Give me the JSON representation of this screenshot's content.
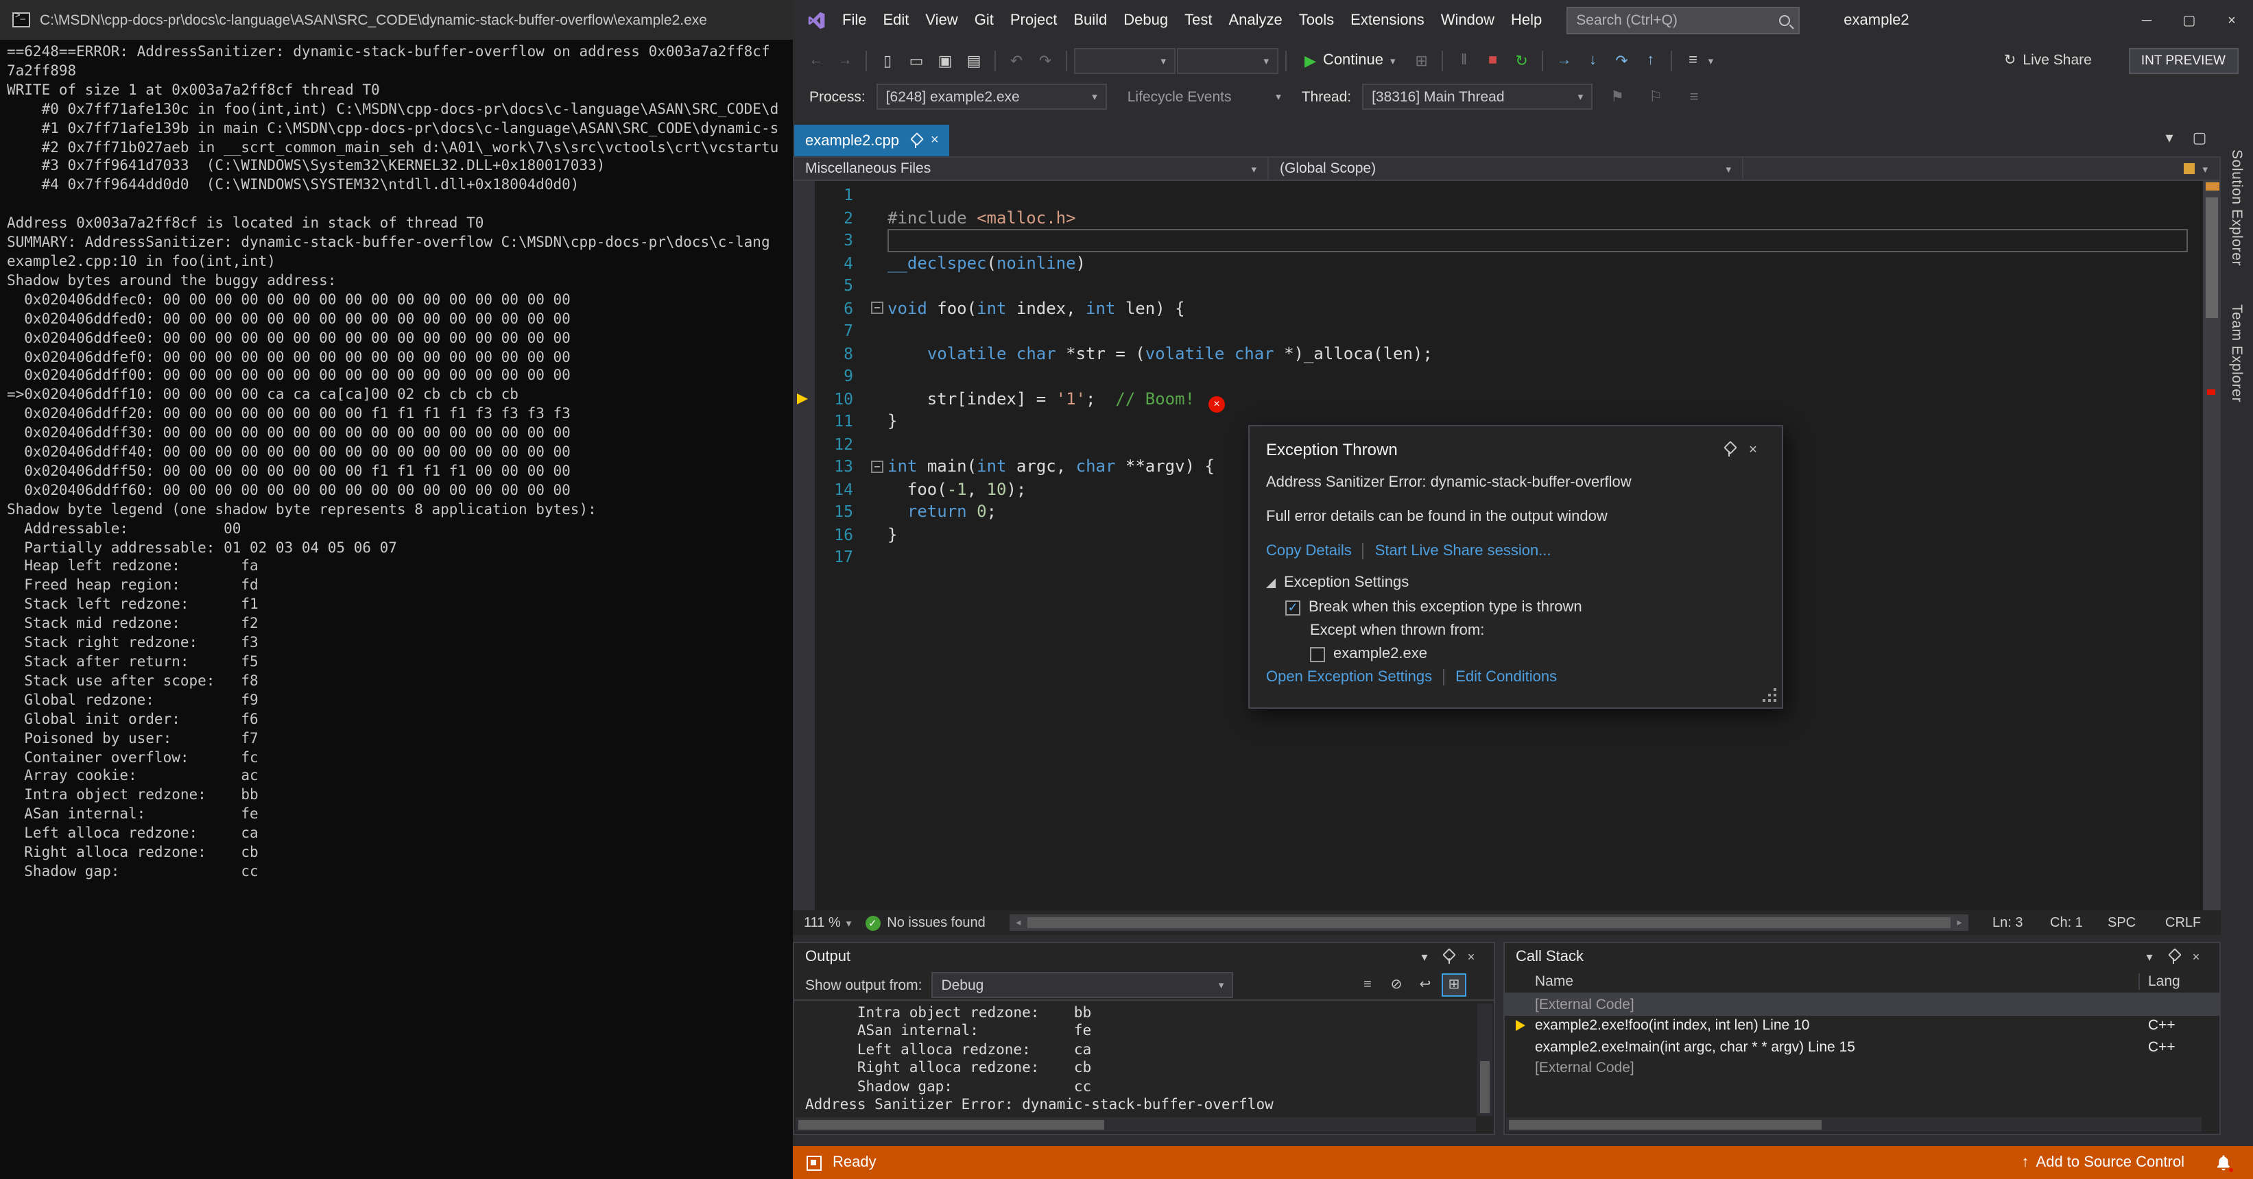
{
  "console": {
    "title": "C:\\MSDN\\cpp-docs-pr\\docs\\c-language\\ASAN\\SRC_CODE\\dynamic-stack-buffer-overflow\\example2.exe",
    "lines": [
      "==6248==ERROR: AddressSanitizer: dynamic-stack-buffer-overflow on address 0x003a7a2ff8cf",
      "7a2ff898",
      "WRITE of size 1 at 0x003a7a2ff8cf thread T0",
      "    #0 0x7ff71afe130c in foo(int,int) C:\\MSDN\\cpp-docs-pr\\docs\\c-language\\ASAN\\SRC_CODE\\d",
      "    #1 0x7ff71afe139b in main C:\\MSDN\\cpp-docs-pr\\docs\\c-language\\ASAN\\SRC_CODE\\dynamic-s",
      "    #2 0x7ff71b027aeb in __scrt_common_main_seh d:\\A01\\_work\\7\\s\\src\\vctools\\crt\\vcstartu",
      "    #3 0x7ff9641d7033  (C:\\WINDOWS\\System32\\KERNEL32.DLL+0x180017033)",
      "    #4 0x7ff9644dd0d0  (C:\\WINDOWS\\SYSTEM32\\ntdll.dll+0x18004d0d0)",
      "",
      "Address 0x003a7a2ff8cf is located in stack of thread T0",
      "SUMMARY: AddressSanitizer: dynamic-stack-buffer-overflow C:\\MSDN\\cpp-docs-pr\\docs\\c-lang",
      "example2.cpp:10 in foo(int,int)",
      "Shadow bytes around the buggy address:",
      "  0x020406ddfec0: 00 00 00 00 00 00 00 00 00 00 00 00 00 00 00 00",
      "  0x020406ddfed0: 00 00 00 00 00 00 00 00 00 00 00 00 00 00 00 00",
      "  0x020406ddfee0: 00 00 00 00 00 00 00 00 00 00 00 00 00 00 00 00",
      "  0x020406ddfef0: 00 00 00 00 00 00 00 00 00 00 00 00 00 00 00 00",
      "  0x020406ddff00: 00 00 00 00 00 00 00 00 00 00 00 00 00 00 00 00",
      "=>0x020406ddff10: 00 00 00 00 ca ca ca[ca]00 02 cb cb cb cb",
      "  0x020406ddff20: 00 00 00 00 00 00 00 00 f1 f1 f1 f1 f3 f3 f3 f3",
      "  0x020406ddff30: 00 00 00 00 00 00 00 00 00 00 00 00 00 00 00 00",
      "  0x020406ddff40: 00 00 00 00 00 00 00 00 00 00 00 00 00 00 00 00",
      "  0x020406ddff50: 00 00 00 00 00 00 00 00 f1 f1 f1 f1 00 00 00 00",
      "  0x020406ddff60: 00 00 00 00 00 00 00 00 00 00 00 00 00 00 00 00",
      "Shadow byte legend (one shadow byte represents 8 application bytes):",
      "  Addressable:           00",
      "  Partially addressable: 01 02 03 04 05 06 07",
      "  Heap left redzone:       fa",
      "  Freed heap region:       fd",
      "  Stack left redzone:      f1",
      "  Stack mid redzone:       f2",
      "  Stack right redzone:     f3",
      "  Stack after return:      f5",
      "  Stack use after scope:   f8",
      "  Global redzone:          f9",
      "  Global init order:       f6",
      "  Poisoned by user:        f7",
      "  Container overflow:      fc",
      "  Array cookie:            ac",
      "  Intra object redzone:    bb",
      "  ASan internal:           fe",
      "  Left alloca redzone:     ca",
      "  Right alloca redzone:    cb",
      "  Shadow gap:              cc"
    ]
  },
  "titlebar": {
    "menus": [
      "File",
      "Edit",
      "View",
      "Git",
      "Project",
      "Build",
      "Debug",
      "Test",
      "Analyze",
      "Tools",
      "Extensions",
      "Window",
      "Help"
    ],
    "search_placeholder": "Search (Ctrl+Q)",
    "window_title": "example2"
  },
  "toolbar": {
    "continue_label": "Continue",
    "live_share_label": "Live Share",
    "preview_badge": "INT PREVIEW"
  },
  "debugbar": {
    "process_label": "Process:",
    "process_value": "[6248] example2.exe",
    "lifecycle_label": "Lifecycle Events",
    "thread_label": "Thread:",
    "thread_value": "[38316] Main Thread"
  },
  "editor": {
    "tab_label": "example2.cpp",
    "nav_project": "Miscellaneous Files",
    "nav_scope": "(Global Scope)",
    "zoom_level": "111 %",
    "issues_text": "No issues found",
    "status": {
      "line": "Ln: 3",
      "column": "Ch: 1",
      "spaces": "SPC",
      "line_ending": "CRLF"
    },
    "lines": [
      {
        "n": 1,
        "tokens": []
      },
      {
        "n": 2,
        "tokens": [
          {
            "t": "#include ",
            "y": "p"
          },
          {
            "t": "<malloc.h>",
            "y": "s"
          }
        ]
      },
      {
        "n": 3,
        "current": true,
        "tokens": []
      },
      {
        "n": 4,
        "tokens": [
          {
            "t": "__declspec",
            "y": "k"
          },
          {
            "t": "(",
            "y": "d"
          },
          {
            "t": "noinline",
            "y": "k"
          },
          {
            "t": ")",
            "y": "d"
          }
        ]
      },
      {
        "n": 5,
        "tokens": []
      },
      {
        "n": 6,
        "fold": true,
        "tokens": [
          {
            "t": "void",
            "y": "k"
          },
          {
            "t": " foo(",
            "y": "d"
          },
          {
            "t": "int",
            "y": "k"
          },
          {
            "t": " index, ",
            "y": "d"
          },
          {
            "t": "int",
            "y": "k"
          },
          {
            "t": " len) {",
            "y": "d"
          }
        ]
      },
      {
        "n": 7,
        "tokens": []
      },
      {
        "n": 8,
        "tokens": [
          {
            "t": "    ",
            "y": "d"
          },
          {
            "t": "volatile",
            "y": "k"
          },
          {
            "t": " ",
            "y": "d"
          },
          {
            "t": "char",
            "y": "k"
          },
          {
            "t": " *str = (",
            "y": "d"
          },
          {
            "t": "volatile",
            "y": "k"
          },
          {
            "t": " ",
            "y": "d"
          },
          {
            "t": "char",
            "y": "k"
          },
          {
            "t": " *)_alloca(len);",
            "y": "d"
          }
        ]
      },
      {
        "n": 9,
        "tokens": []
      },
      {
        "n": 10,
        "arrow": true,
        "error": true,
        "tokens": [
          {
            "t": "    str[index] = ",
            "y": "d"
          },
          {
            "t": "'1'",
            "y": "s"
          },
          {
            "t": ";  ",
            "y": "d"
          },
          {
            "t": "// Boom!",
            "y": "c"
          }
        ]
      },
      {
        "n": 11,
        "tokens": [
          {
            "t": "}",
            "y": "d"
          }
        ]
      },
      {
        "n": 12,
        "tokens": []
      },
      {
        "n": 13,
        "fold": true,
        "tokens": [
          {
            "t": "int",
            "y": "k"
          },
          {
            "t": " main(",
            "y": "d"
          },
          {
            "t": "int",
            "y": "k"
          },
          {
            "t": " argc, ",
            "y": "d"
          },
          {
            "t": "char",
            "y": "k"
          },
          {
            "t": " **argv) {",
            "y": "d"
          }
        ]
      },
      {
        "n": 14,
        "tokens": [
          {
            "t": "  foo(",
            "y": "d"
          },
          {
            "t": "-1",
            "y": "n"
          },
          {
            "t": ", ",
            "y": "d"
          },
          {
            "t": "10",
            "y": "n"
          },
          {
            "t": ");",
            "y": "d"
          }
        ]
      },
      {
        "n": 15,
        "tokens": [
          {
            "t": "  ",
            "y": "d"
          },
          {
            "t": "return",
            "y": "k"
          },
          {
            "t": " ",
            "y": "d"
          },
          {
            "t": "0",
            "y": "n"
          },
          {
            "t": ";",
            "y": "d"
          }
        ]
      },
      {
        "n": 16,
        "tokens": [
          {
            "t": "}",
            "y": "d"
          }
        ]
      },
      {
        "n": 17,
        "tokens": []
      }
    ]
  },
  "exception": {
    "title": "Exception Thrown",
    "message": "Address Sanitizer Error: dynamic-stack-buffer-overflow",
    "detail": "Full error details can be found in the output window",
    "copy_details_label": "Copy Details",
    "live_share_link_label": "Start Live Share session...",
    "settings_header": "Exception Settings",
    "break_label": "Break when this exception type is thrown",
    "break_checked": true,
    "except_label": "Except when thrown from:",
    "module_label": "example2.exe",
    "module_checked": false,
    "open_settings_label": "Open Exception Settings",
    "edit_conditions_label": "Edit Conditions"
  },
  "output": {
    "title": "Output",
    "show_from_label": "Show output from:",
    "selected_source": "Debug",
    "lines": [
      "      Intra object redzone:    bb",
      "      ASan internal:           fe",
      "      Left alloca redzone:     ca",
      "      Right alloca redzone:    cb",
      "      Shadow gap:              cc",
      "Address Sanitizer Error: dynamic-stack-buffer-overflow"
    ]
  },
  "callstack": {
    "title": "Call Stack",
    "columns": [
      "Name",
      "Lang"
    ],
    "rows": [
      {
        "name": "[External Code]",
        "lang": "",
        "external": true,
        "selected": true
      },
      {
        "name": "example2.exe!foo(int index, int len) Line 10",
        "lang": "C++",
        "current": true
      },
      {
        "name": "example2.exe!main(int argc, char * * argv) Line 15",
        "lang": "C++"
      },
      {
        "name": "[External Code]",
        "lang": "",
        "external": true
      }
    ]
  },
  "side_tabs": [
    "Solution Explorer",
    "Team Explorer"
  ],
  "statusbar": {
    "ready_label": "Ready",
    "source_control_label": "Add to Source Control"
  },
  "icons": {
    "minimize": "─",
    "maximize": "▢",
    "close": "×",
    "nav_back": "←",
    "nav_forward": "→",
    "new_file": "▯",
    "open_file": "▭",
    "save": "▣",
    "save_all": "▤",
    "undo": "↶",
    "redo": "↷",
    "dropdown": "▾",
    "play": "▶",
    "pause": "‖",
    "stop": "■",
    "restart": "↻",
    "step_into": "↓",
    "step_over": "↷",
    "step_out": "↑",
    "flag": "⚑",
    "flag_outline": "⚐",
    "list": "≡",
    "left_small": "◂",
    "right_small": "▸",
    "up_small": "▴",
    "check": "✓",
    "error_x": "×",
    "fold_collapse": "−",
    "clear": "⊘",
    "wrap": "↩",
    "grid": "⊞",
    "publish_up": "↑"
  },
  "colors": {
    "accent": "#007acc",
    "debug_statusbar": "#ca5100",
    "active_tab": "#1f6fa8",
    "error": "#e51400",
    "line_number": "#2b91af",
    "keyword": "#569cd6",
    "string": "#d69d85",
    "comment": "#57a64a",
    "number": "#b5cea8",
    "link": "#4e9fe0",
    "current_statement_arrow": "#ffcc00"
  }
}
